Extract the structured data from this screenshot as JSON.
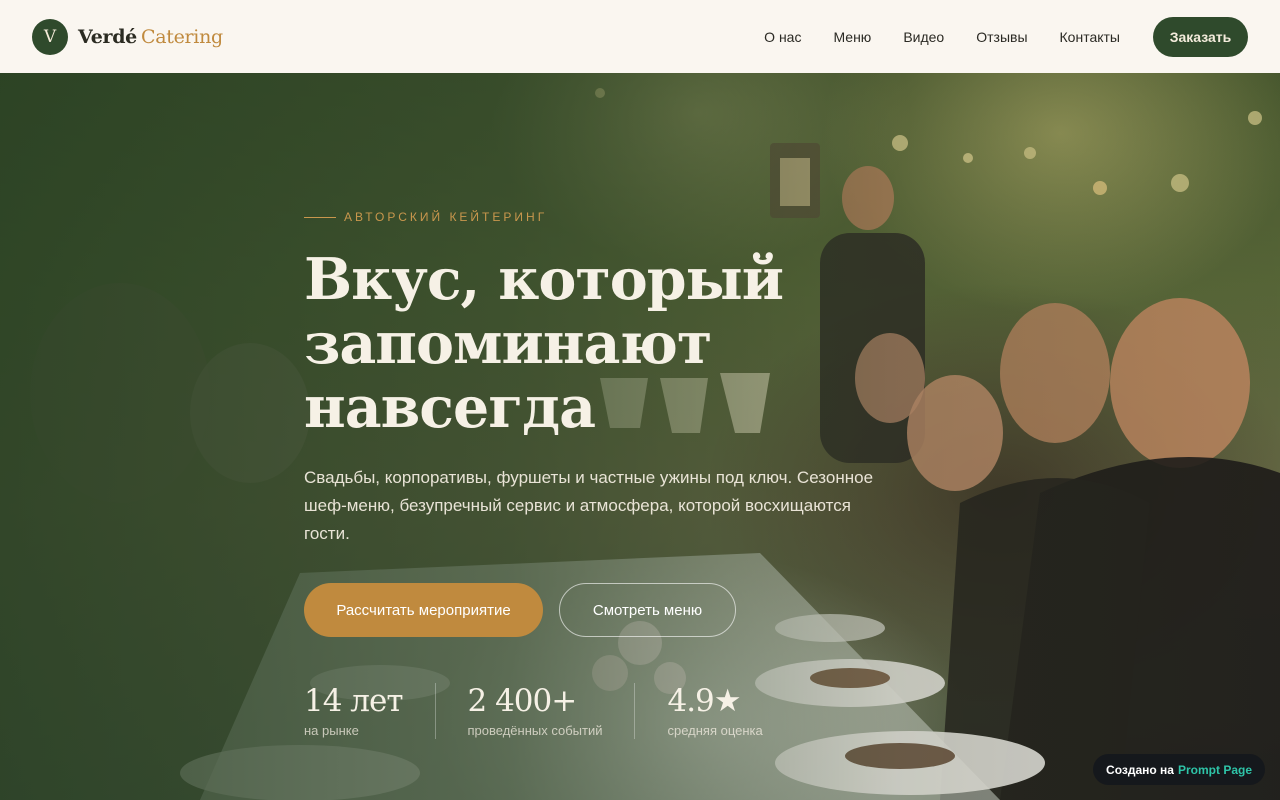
{
  "header": {
    "logo_letter": "V",
    "brand_main": "Verdé",
    "brand_accent": "Catering",
    "nav": [
      "О нас",
      "Меню",
      "Видео",
      "Отзывы",
      "Контакты"
    ],
    "order_button": "Заказать"
  },
  "hero": {
    "eyebrow": "Авторский кейтеринг",
    "headline": "Вкус, который запоминают навсегда",
    "subtitle": "Свадьбы, корпоративы, фуршеты и частные ужины под ключ. Сезонное шеф-меню, безупречный сервис и атмосфера, которой восхищаются гости.",
    "cta_primary": "Рассчитать мероприятие",
    "cta_secondary": "Смотреть меню",
    "stats": [
      {
        "value": "14 лет",
        "label": "на рынке"
      },
      {
        "value": "2 400+",
        "label": "проведённых событий"
      },
      {
        "value": "4.9★",
        "label": "средняя оценка"
      }
    ]
  },
  "badge": {
    "prefix": "Создано на",
    "accent": "Prompt Page"
  },
  "colors": {
    "brand_green": "#2f4a2c",
    "accent_gold": "#c08a3e",
    "cream": "#faf6f0",
    "badge_accent": "#2ec4a8"
  }
}
